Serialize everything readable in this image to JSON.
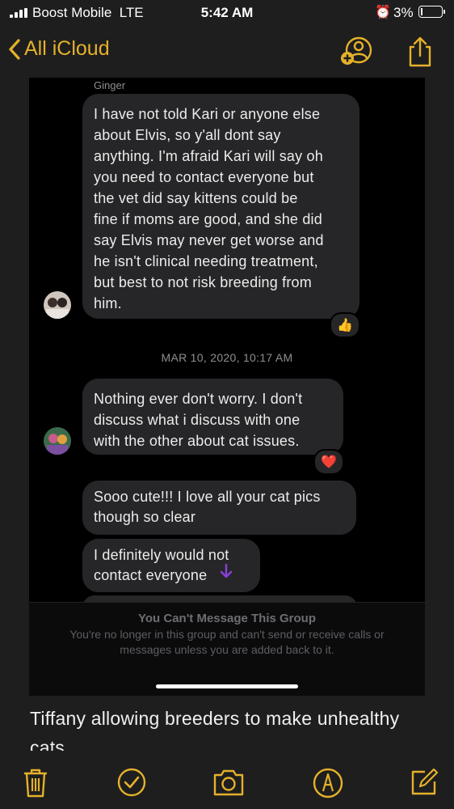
{
  "status_bar": {
    "carrier": "Boost Mobile",
    "network": "LTE",
    "time": "5:42 AM",
    "battery": "3%",
    "battery_level": 0.03
  },
  "nav": {
    "back_label": "All iCloud",
    "icons": [
      "add-person-icon",
      "share-icon"
    ]
  },
  "messages": {
    "sender_name": "Ginger",
    "msg1": "I have not told Kari or anyone else\nabout Elvis, so y'all dont say\nanything. I'm afraid Kari will say oh\nyou need to contact everyone but\nthe vet did say kittens could be\nfine if moms are good, and she did\nsay Elvis may never get worse and\nhe isn't clinical needing treatment,\nbut best to not risk breeding from\nhim.",
    "msg1_tapback": "👍",
    "timestamp": "MAR 10, 2020, 10:17 AM",
    "msg2": "Nothing ever don't worry. I don't\ndiscuss what i discuss with one\nwith the other about cat issues.",
    "msg2_tapback": "❤️",
    "msg3": "Sooo cute!!! I love all your cat pics\nthough so clear",
    "msg4": "I definitely would not\ncontact everyone"
  },
  "notice": {
    "title": "You Can't Message This Group",
    "body": "You're no longer in this group and can't send or receive calls or messages unless you are added back to it."
  },
  "note_text": "Tiffany allowing breeders to make unhealthy cats",
  "toolbar": {
    "icons": [
      "trash-icon",
      "checklist-icon",
      "camera-icon",
      "markup-icon",
      "compose-icon"
    ]
  },
  "colors": {
    "accent": "#e5b12b",
    "note_background": "#1e1e1e",
    "bubble_gray": "#262628",
    "message_background": "#000000"
  }
}
